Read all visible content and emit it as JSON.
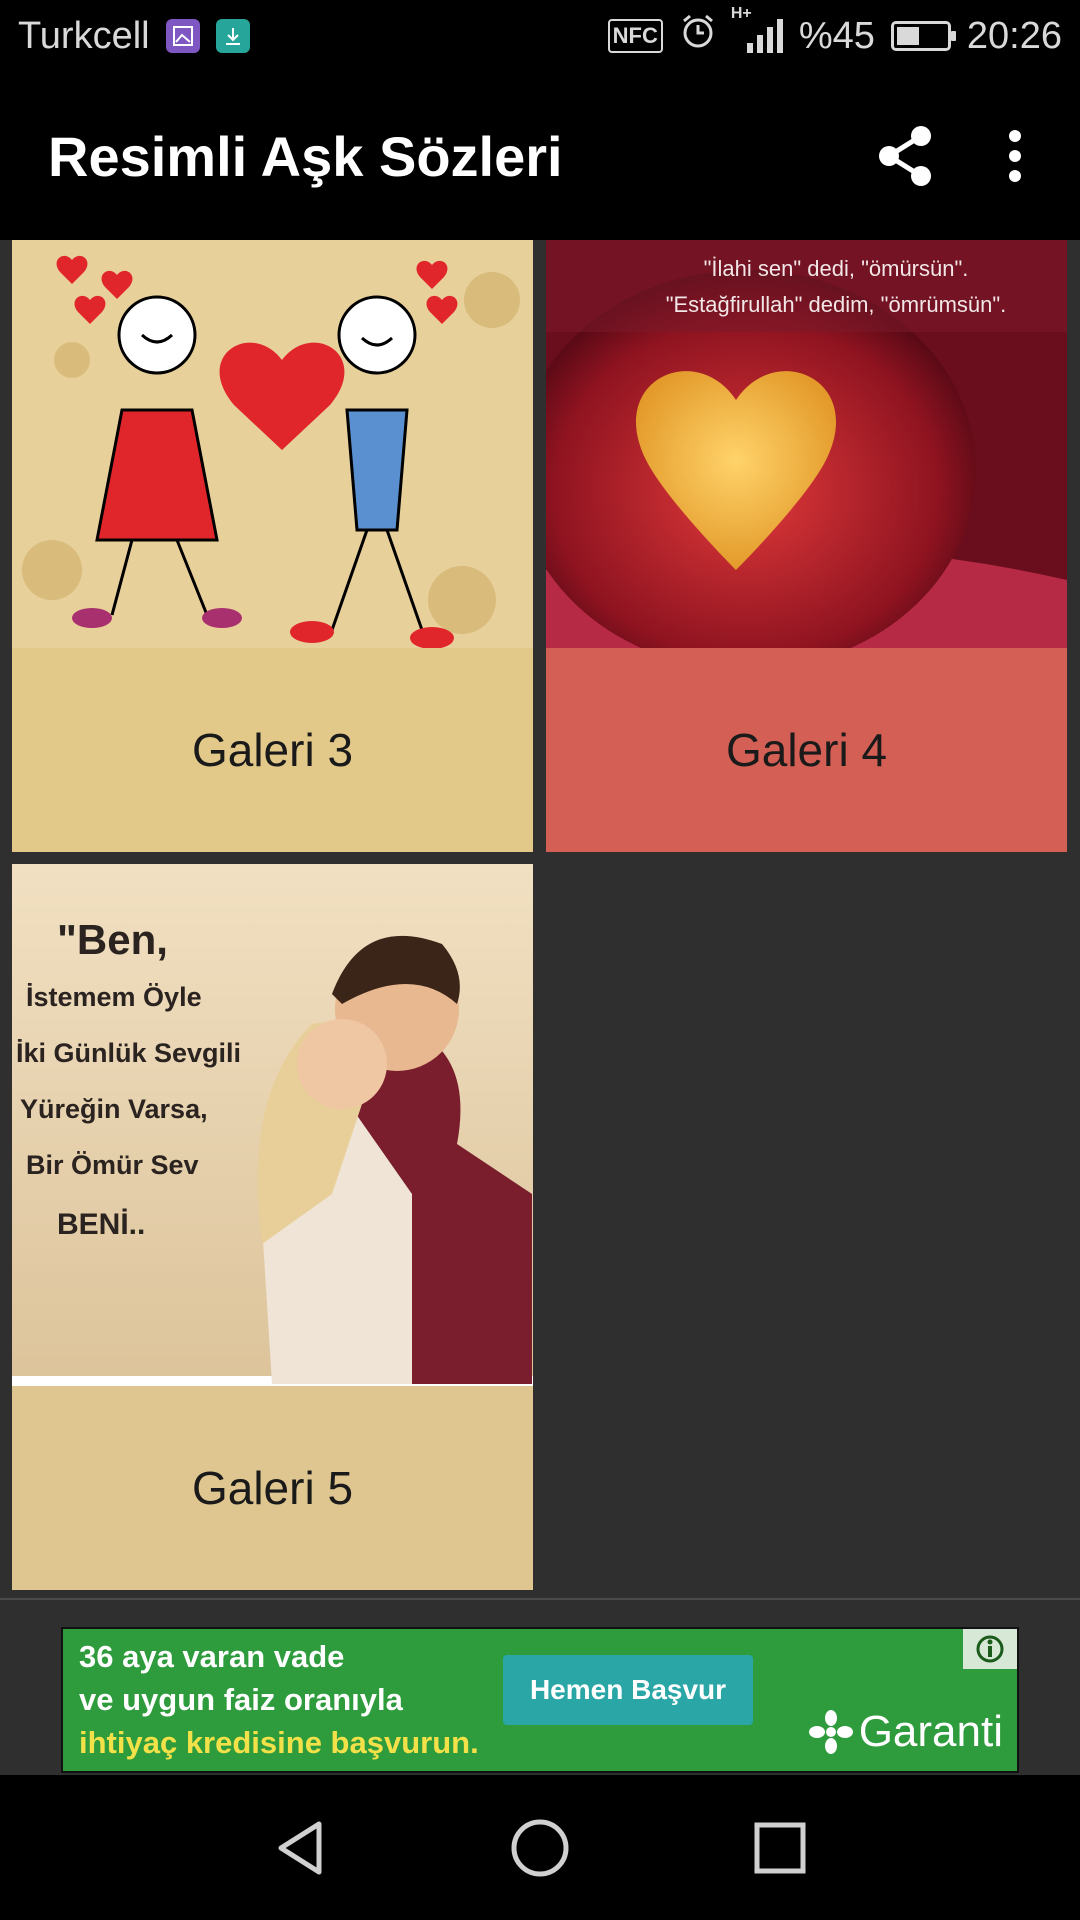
{
  "status_bar": {
    "carrier": "Turkcell",
    "notification_icons": [
      "gallery-icon",
      "download-icon"
    ],
    "nfc": "NFC",
    "network": "H+",
    "battery_percent_text": "%45",
    "battery_level": 0.45,
    "time": "20:26"
  },
  "app_bar": {
    "title": "Resimli Aşk Sözleri",
    "actions": [
      "share-icon",
      "more-vert-icon"
    ]
  },
  "gallery": [
    {
      "label": "Galeri 3",
      "label_bg": "#e2c98a"
    },
    {
      "label": "Galeri 4",
      "label_bg": "#d45f55",
      "image_caption_lines": [
        "\"İlahi sen\" dedi, \"ömürsün\".",
        "\"Estağfirullah\" dedim, \"ömrümsün\"."
      ]
    },
    {
      "label": "Galeri 5",
      "label_bg": "#dfc690",
      "image_caption_lines": [
        "\"Ben,",
        "İstemem Öyle",
        "İki Günlük Sevgili",
        "Yüreğin Varsa,",
        "Bir Ömür Sev",
        "BENİ.."
      ]
    }
  ],
  "ad": {
    "lines": [
      "36 aya varan vade",
      "ve uygun faiz oranıyla",
      "ihtiyaç kredisine başvurun."
    ],
    "cta": "Hemen Başvur",
    "brand": "Garanti",
    "info_icon": "info-icon"
  },
  "nav_bar": [
    "back-icon",
    "home-icon",
    "recents-icon"
  ]
}
